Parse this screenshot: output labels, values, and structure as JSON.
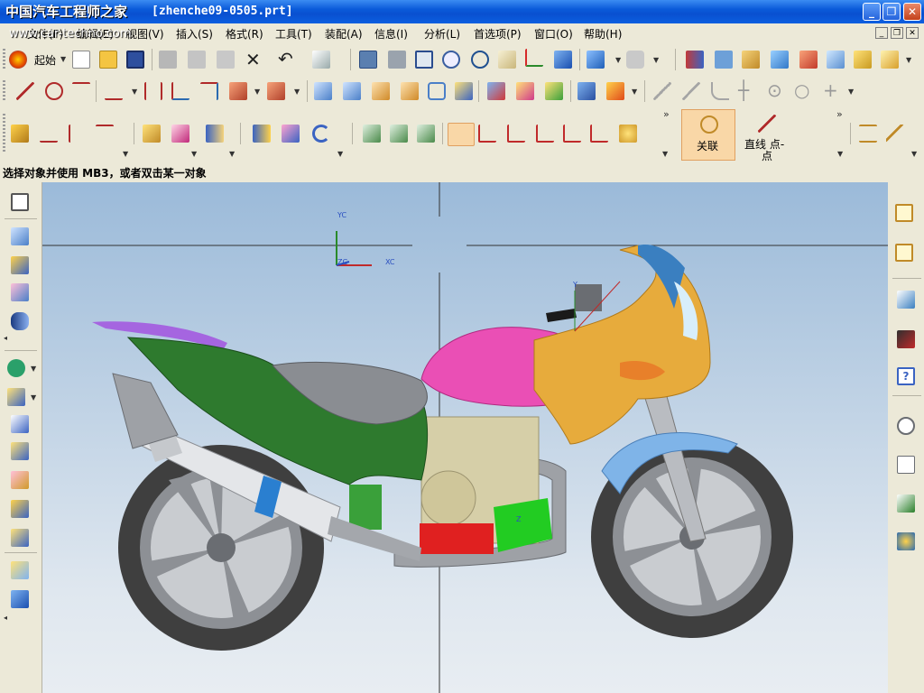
{
  "window": {
    "title": "[zhenche09-0505.prt]",
    "watermark_site": "www.car-techno.com",
    "colors": {
      "titlebar": "#0a5ad9",
      "chrome": "#ece9d8",
      "accent_button": "#f9d7a7"
    }
  },
  "menu": {
    "items": [
      {
        "label": "文件(F)"
      },
      {
        "label": "编辑(E)"
      },
      {
        "label": "视图(V)"
      },
      {
        "label": "插入(S)"
      },
      {
        "label": "格式(R)"
      },
      {
        "label": "工具(T)"
      },
      {
        "label": "装配(A)"
      },
      {
        "label": "信息(I)"
      },
      {
        "label": "分析(L)"
      },
      {
        "label": "首选项(P)"
      },
      {
        "label": "窗口(O)"
      },
      {
        "label": "帮助(H)"
      }
    ]
  },
  "toolbar": {
    "start_label": "起始",
    "associate_label": "关联",
    "line_point_label": "直线 点-",
    "line_point_label2": "点"
  },
  "cue_line": "选择对象并使用 MB3，或者双击某一对象",
  "viewport": {
    "wcs_y_label": "YC",
    "wcs_z_label": "ZC",
    "wcs_x_label": "XC",
    "local_y_label": "Y",
    "local_z_label": "Z"
  }
}
